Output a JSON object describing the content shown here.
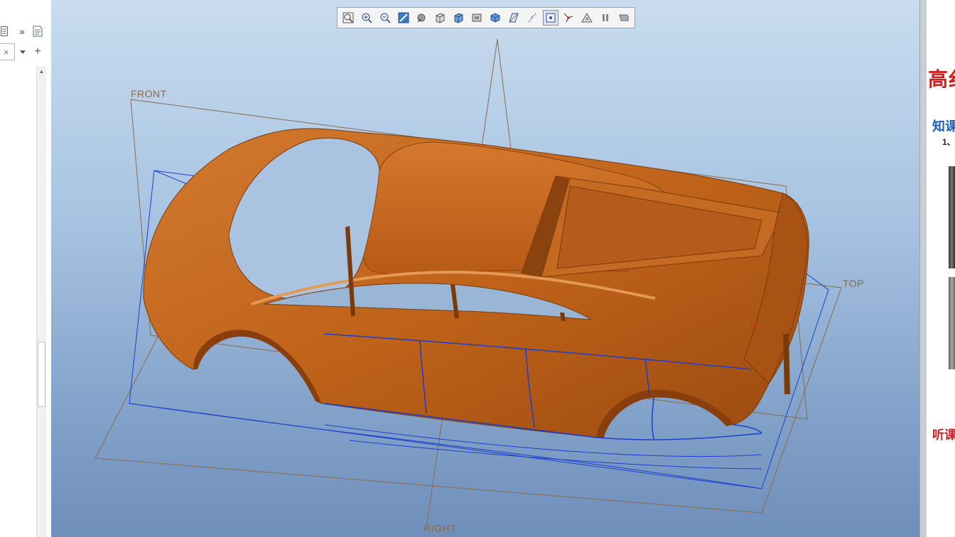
{
  "toolbar": {
    "buttons": [
      {
        "name": "zoom-fit-button",
        "icon": "zoom-fit-icon"
      },
      {
        "name": "zoom-in-button",
        "icon": "zoom-in-icon"
      },
      {
        "name": "zoom-out-button",
        "icon": "zoom-out-icon"
      },
      {
        "name": "repaint-button",
        "icon": "repaint-icon"
      },
      {
        "name": "shaded-display-button",
        "icon": "shading-icon"
      },
      {
        "name": "no-hidden-button",
        "icon": "wireframe-box-icon"
      },
      {
        "name": "saved-views-button",
        "icon": "saved-views-icon"
      },
      {
        "name": "layers-button",
        "icon": "layers-icon"
      },
      {
        "name": "display-style-button",
        "icon": "cube-icon"
      },
      {
        "name": "datum-planes-button",
        "icon": "datum-plane-icon"
      },
      {
        "name": "datum-axes-button",
        "icon": "datum-axis-icon"
      },
      {
        "name": "datum-points-button",
        "icon": "datum-point-icon",
        "active": true
      },
      {
        "name": "csys-button",
        "icon": "coordinate-system-icon"
      },
      {
        "name": "annotation-button",
        "icon": "triangle-icon"
      },
      {
        "name": "pause-button",
        "icon": "pause-icon"
      },
      {
        "name": "flag-button",
        "icon": "flag-icon"
      }
    ]
  },
  "viewport": {
    "planes": {
      "front": "FRONT",
      "top": "TOP",
      "right": "RIGHT"
    },
    "model_color": "#c0631a",
    "plane_color": "#8a6a4a",
    "curve_color": "#1a3fd0"
  },
  "left_panel": {
    "icons": [
      "list-icon",
      "more-icon",
      "document-icon",
      "close-icon",
      "dropdown-icon",
      "add-icon"
    ],
    "more_label": "»"
  },
  "doc": {
    "title": "高纟",
    "subtitle": "知课",
    "line1": "1、",
    "footer": "听课"
  },
  "colors": {
    "viewport_top": "#c9dcef",
    "viewport_bottom": "#6f8fbb",
    "doc_red": "#cc1f1f",
    "doc_blue": "#1f5fbf"
  }
}
